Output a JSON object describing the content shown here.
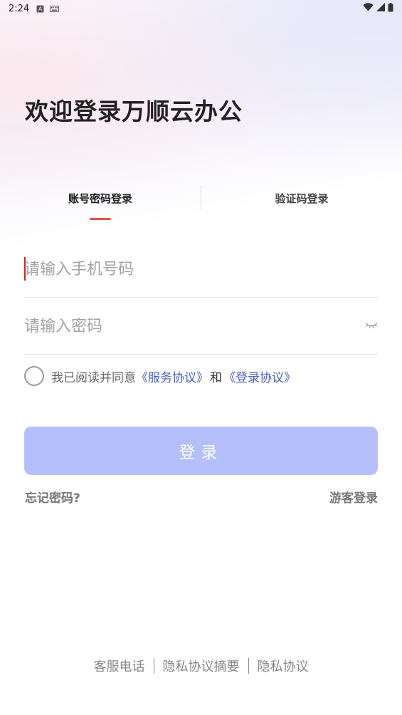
{
  "status_bar": {
    "time": "2:24",
    "icons": [
      "a-icon",
      "keyboard-icon"
    ],
    "right_icons": [
      "wifi-icon",
      "signal-icon",
      "battery-icon"
    ]
  },
  "page_title": "欢迎登录万顺云办公",
  "tabs": [
    {
      "label": "账号密码登录",
      "active": true
    },
    {
      "label": "验证码登录",
      "active": false
    }
  ],
  "phone_field": {
    "placeholder": "请输入手机号码",
    "value": ""
  },
  "password_field": {
    "placeholder": "请输入密码",
    "value": ""
  },
  "agreement": {
    "prefix": "我已阅读并同意",
    "service_link": "《服务协议》",
    "and": "和",
    "login_link": "《登录协议》",
    "checked": false
  },
  "login_button": "登录",
  "forgot_password": "忘记密码?",
  "guest_login": "游客登录",
  "footer": {
    "items": [
      "客服电话",
      "隐私协议摘要",
      "隐私协议"
    ]
  },
  "colors": {
    "accent_red": "#e4524b",
    "link_blue": "#4a5fc7",
    "button_disabled": "#b5bffb"
  }
}
